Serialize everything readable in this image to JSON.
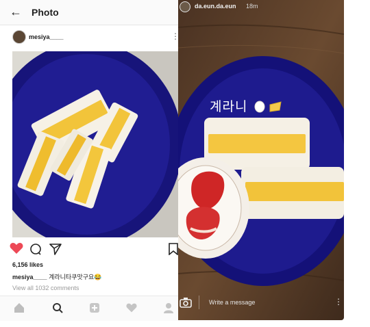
{
  "left_panel": {
    "header": {
      "back_icon": "arrow-left-icon",
      "title": "Photo"
    },
    "post": {
      "username": "mesiya____",
      "more_icon": "more-vertical-icon",
      "actions": {
        "like_icon": "heart-filled-icon",
        "comment_icon": "comment-icon",
        "share_icon": "send-icon",
        "save_icon": "bookmark-icon",
        "like_color": "#ed4956"
      },
      "likes": "6,156 likes",
      "caption_user": "mesiya____",
      "caption_text": "계라니타쿠맛구요😂",
      "view_comments": "View all 1032 comments"
    },
    "bottom_nav": [
      "home-icon",
      "search-icon",
      "add-icon",
      "heart-icon",
      "profile-icon"
    ]
  },
  "right_panel": {
    "story": {
      "username": "da.eun.da.eun",
      "time": "18m",
      "sticker_text": "계라니",
      "sticker_emojis": [
        "egg-emoji",
        "cheese-emoji"
      ],
      "camera_icon": "camera-icon",
      "message_placeholder": "Write a message",
      "more_icon": "more-vertical-icon"
    }
  },
  "colors": {
    "plate_blue": "#1f1c8c",
    "bread": "#f4efe4",
    "cheese": "#f1c232",
    "wood": "#5a3c25",
    "strawberry": "#d42a2a"
  }
}
